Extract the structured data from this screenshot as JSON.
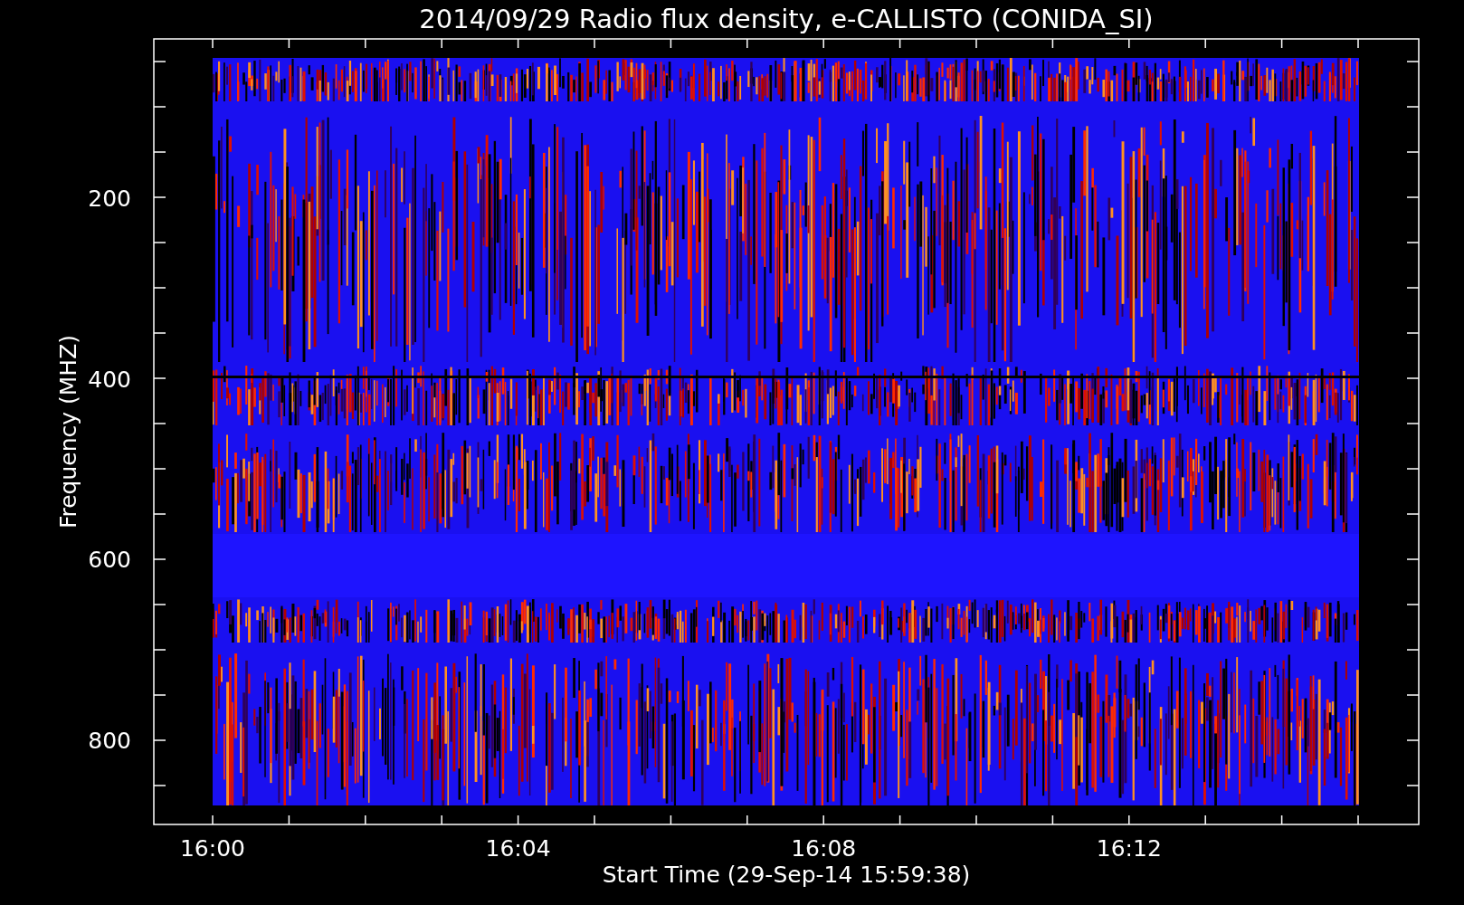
{
  "title": "2014/09/29  Radio flux density, e-CALLISTO (CONIDA_SI)",
  "plot": {
    "ylabel": "Frequency (MHZ)",
    "xlabel": "Start Time (29-Sep-14 15:59:38)",
    "yticks": [
      "200",
      "400",
      "600",
      "800"
    ],
    "xticks": [
      "16:00",
      "16:04",
      "16:08",
      "16:12"
    ]
  }
}
